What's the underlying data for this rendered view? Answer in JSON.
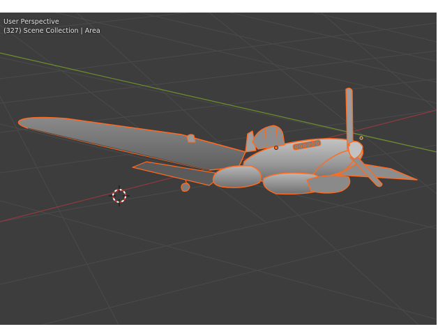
{
  "viewport": {
    "perspective_label": "User Perspective",
    "collection_label": "(327) Scene Collection | Area"
  },
  "colors": {
    "background": "#3d3d3d",
    "grid": "#4a4a4a",
    "x_axis": "#8f3a3f",
    "y_axis": "#6d8f2e",
    "selection_outline": "#ff6a1f",
    "model_gray": "#9a9a9a"
  },
  "icons": [
    "3d-cursor-icon",
    "object-origin-icon"
  ]
}
